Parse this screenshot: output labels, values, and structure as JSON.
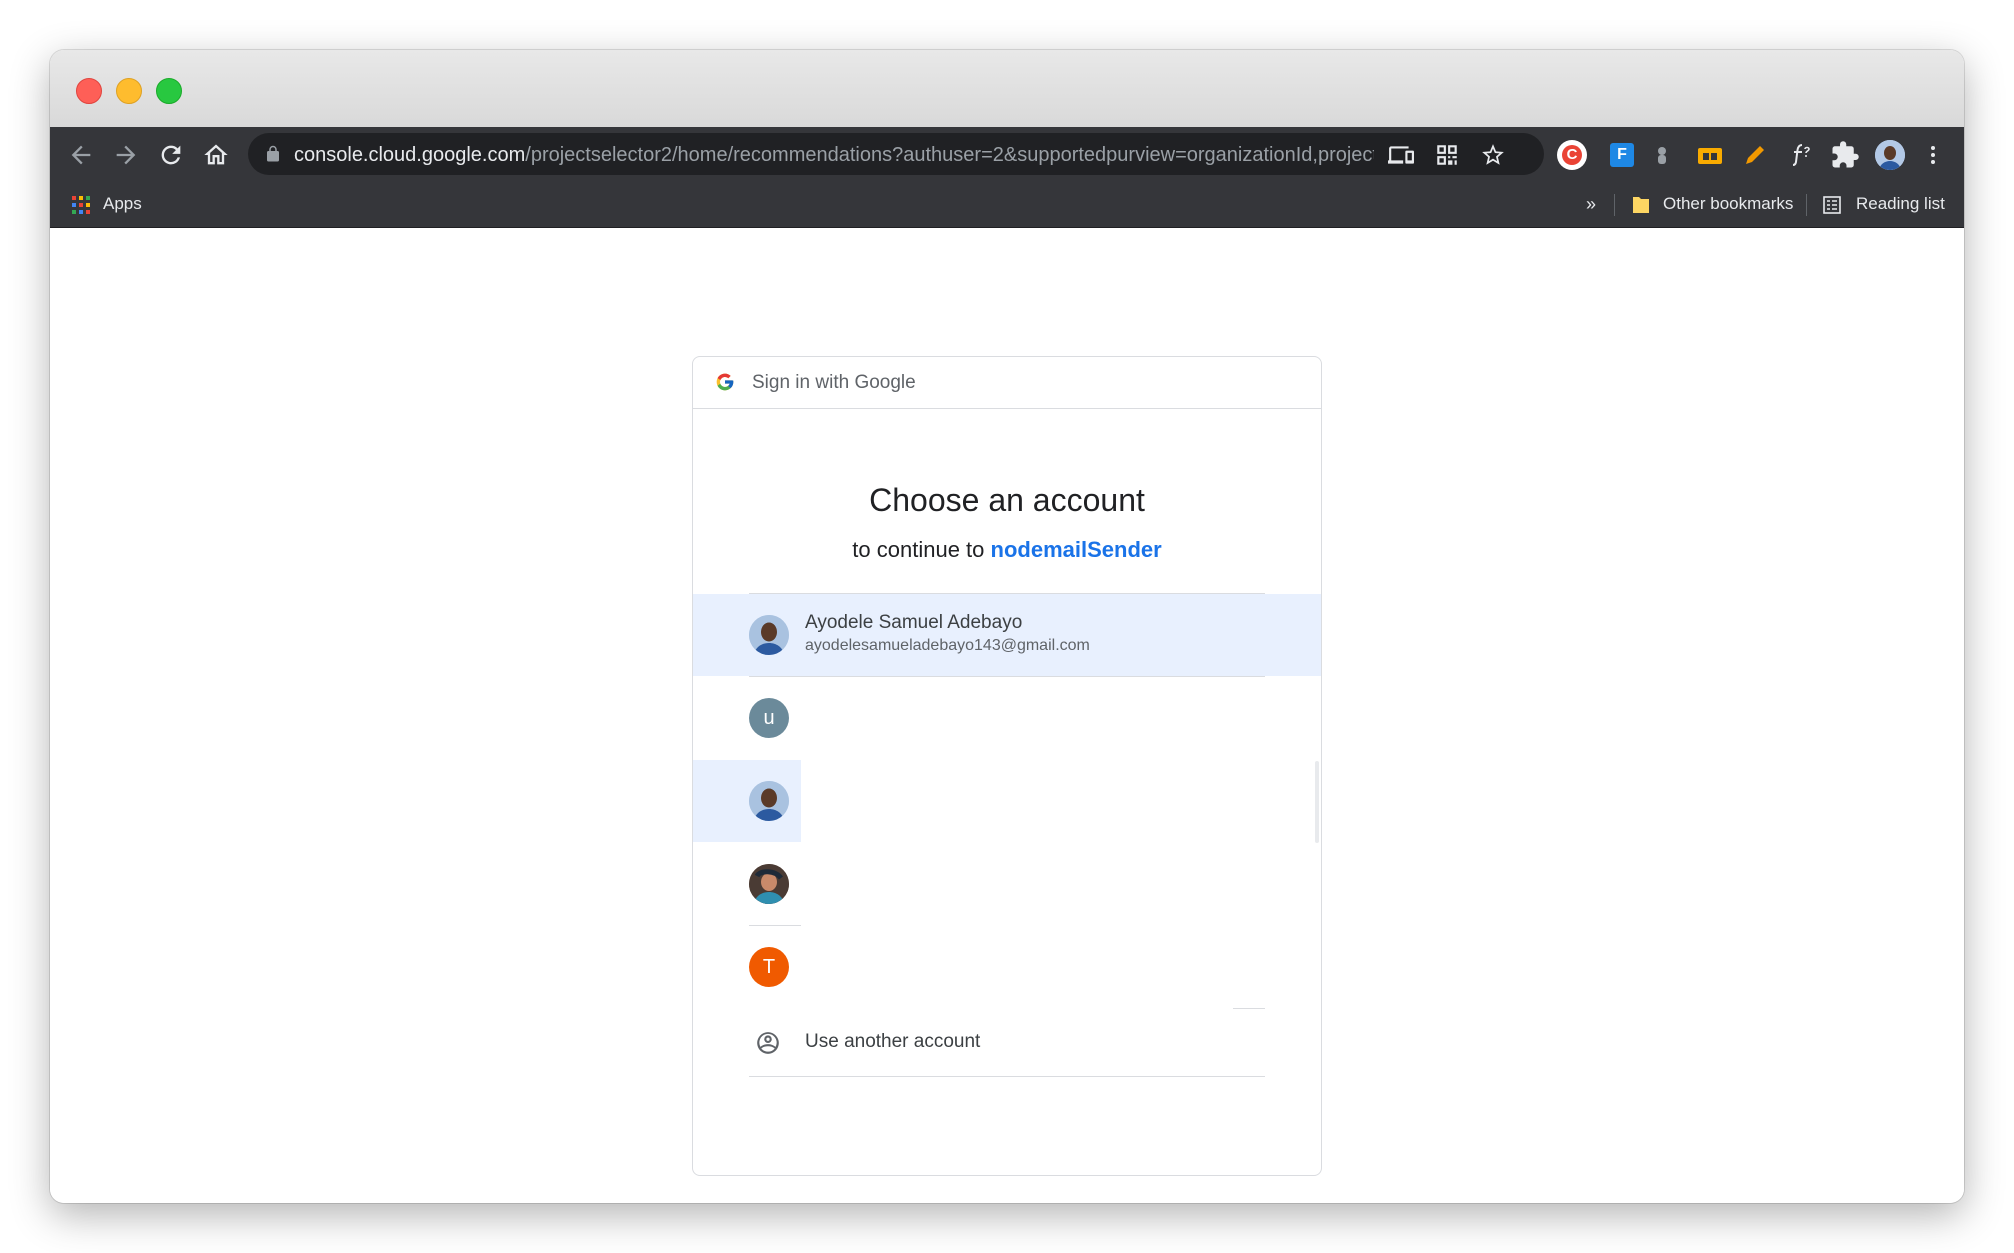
{
  "browser": {
    "url_host": "console.cloud.google.com",
    "url_path": "/projectselector2/home/recommendations?authuser=2&supportedpurview=organizationId,project.f...",
    "bookmarks": {
      "apps_label": "Apps",
      "more_label": "»",
      "other_bookmarks": "Other bookmarks",
      "reading_list": "Reading list"
    },
    "extensions": {
      "ext1_letter": "C",
      "ext2_letter": "F"
    },
    "colors": {
      "toolbar": "#35363a",
      "omnibox": "#202124"
    }
  },
  "signin": {
    "header": "Sign in with Google",
    "title": "Choose an account",
    "subtitle_prefix": "to continue to",
    "app_name": "nodemailSender",
    "accounts": [
      {
        "name": "Ayodele Samuel Adebayo",
        "email": "ayodelesamueladebayo143@gmail.com",
        "avatar": "photo"
      },
      {
        "avatar_letter": "u",
        "avatar_color": "#6b8a9a"
      },
      {
        "avatar": "photo"
      },
      {
        "avatar": "photo"
      },
      {
        "avatar_letter": "T",
        "avatar_color": "#f05a00"
      }
    ],
    "use_another": "Use another account",
    "colors": {
      "accent": "#1a73e8",
      "highlight": "#e8f0fe"
    }
  }
}
